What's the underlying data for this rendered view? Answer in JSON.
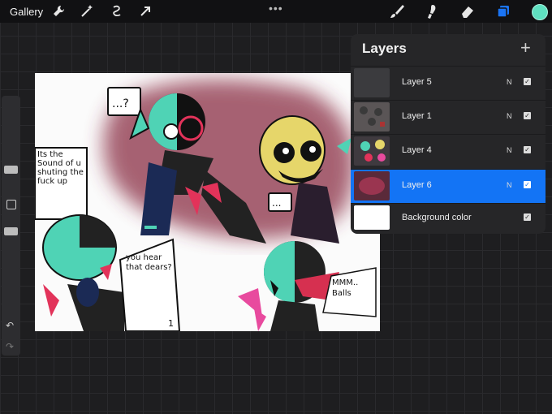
{
  "toolbar": {
    "gallery_label": "Gallery",
    "more_label": "•••",
    "accent_color": "#1a74f5",
    "current_color": "#5fe0c0",
    "icons": [
      "wrench-icon",
      "magic-wand-icon",
      "selection-icon",
      "transform-arrow-icon",
      "brush-icon",
      "smudge-icon",
      "eraser-icon",
      "layers-icon"
    ]
  },
  "layers_panel": {
    "title": "Layers",
    "add_label": "+",
    "layers": [
      {
        "name": "Layer 5",
        "mode": "N",
        "visible": true,
        "active": false
      },
      {
        "name": "Layer 1",
        "mode": "N",
        "visible": true,
        "active": false
      },
      {
        "name": "Layer 4",
        "mode": "N",
        "visible": true,
        "active": false
      },
      {
        "name": "Layer 6",
        "mode": "N",
        "visible": true,
        "active": true
      },
      {
        "name": "Background color",
        "mode": "",
        "visible": true,
        "active": false
      }
    ]
  },
  "sidebar": {
    "undo_label": "↶",
    "redo_label": "↷"
  },
  "canvas": {
    "bubble_top": "...?",
    "bubble_mid": "...",
    "caption_left": "Its the Sound of u shuting the fuck up",
    "caption_bottom": "you hear that dears?",
    "caption_number": "1",
    "caption_right": "MMM.. Balls"
  }
}
